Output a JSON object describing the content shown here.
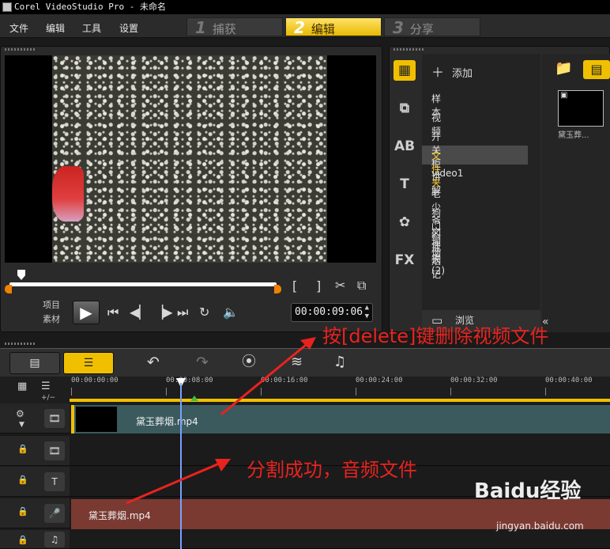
{
  "window": {
    "title": "Corel VideoStudio Pro - 未命名"
  },
  "menu": {
    "items": [
      "文件",
      "编辑",
      "工具",
      "设置"
    ]
  },
  "steps": [
    {
      "num": "1",
      "label": "捕获"
    },
    {
      "num": "2",
      "label": "编辑"
    },
    {
      "num": "3",
      "label": "分享"
    }
  ],
  "player": {
    "mode_project": "项目",
    "mode_clip": "素材",
    "timecode": "00:00:09:06",
    "mark_in": "[",
    "mark_out": "]"
  },
  "library": {
    "add_label": "添加",
    "folders": [
      "样本",
      "视频",
      "开关柜讲解",
      "文件夹",
      "video1",
      "老少爷们戒烟记",
      "狗门销烟",
      "文件夹 (2)"
    ],
    "selected_folder": "文件夹",
    "browse_label": "浏览",
    "thumb_label": "黛玉葬..."
  },
  "timeline": {
    "ruler_labels": [
      "00:00:00:00",
      "00:00:08:00",
      "00:00:16:00",
      "00:00:24:00",
      "00:00:32:00",
      "00:00:40:00"
    ],
    "zoom_label": "+/−",
    "video_clip": "黛玉葬烟.mp4",
    "audio_clip": "黛玉葬烟.mp4"
  },
  "annotations": {
    "delete_note": "按[delete]键删除视频文件",
    "split_note": "分割成功，音频文件"
  },
  "watermark": {
    "brand": "Baidu经验",
    "url": "jingyan.baidu.com"
  },
  "colors": {
    "accent": "#f0c000",
    "annotation": "#e8231f",
    "audio_clip": "#7a3a32",
    "video_clip": "#3b5a5e"
  }
}
